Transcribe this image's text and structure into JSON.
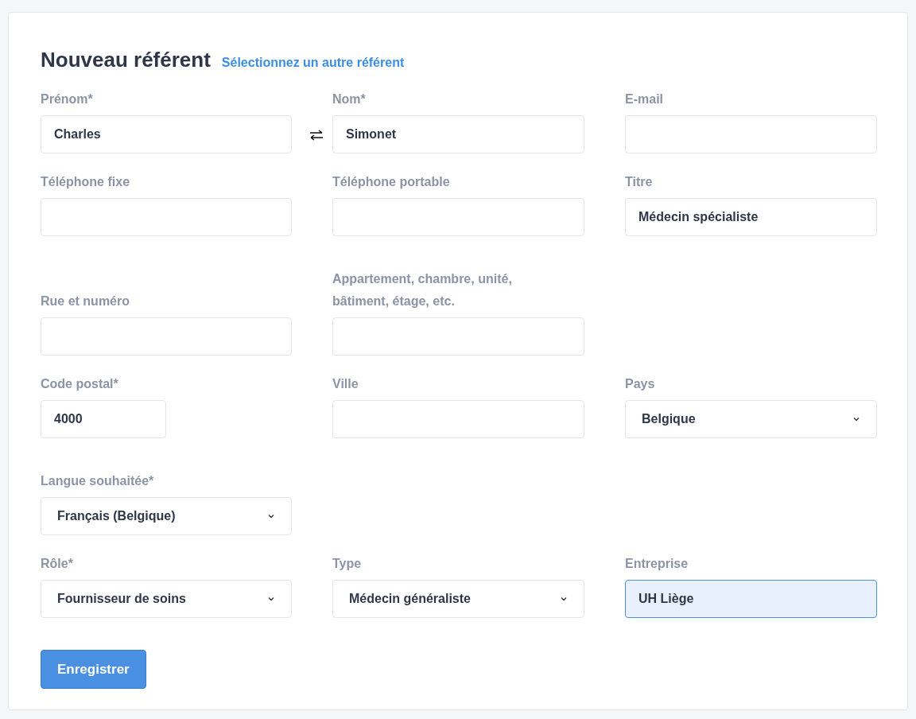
{
  "header": {
    "title": "Nouveau référent",
    "link": "Sélectionnez un autre référent"
  },
  "sections": [
    {
      "rows": [
        [
          {
            "kind": "text",
            "label": "Prénom*",
            "value": "Charles",
            "swap_button": true
          },
          {
            "kind": "text",
            "label": "Nom*",
            "value": "Simonet"
          },
          {
            "kind": "text",
            "label": "E-mail"
          }
        ],
        [
          {
            "kind": "text",
            "label": "Téléphone fixe"
          },
          {
            "kind": "text",
            "label": "Téléphone portable"
          },
          {
            "kind": "text",
            "label": "Titre",
            "value": "Médecin spécialiste"
          }
        ]
      ]
    },
    {
      "rows": [
        [
          {
            "kind": "text",
            "label": "Rue et numéro"
          },
          {
            "kind": "text",
            "label": "Appartement, chambre, unité, bâtiment, étage, etc."
          },
          {
            "kind": "empty"
          }
        ],
        [
          {
            "kind": "text",
            "label": "Code postal*",
            "value": "4000",
            "short": true
          },
          {
            "kind": "text",
            "label": "Ville"
          },
          {
            "kind": "select",
            "label": "Pays",
            "value": "Belgique"
          }
        ]
      ]
    },
    {
      "rows": [
        [
          {
            "kind": "select",
            "label": "Langue souhaitée*",
            "value": "Français (Belgique)"
          },
          {
            "kind": "empty"
          },
          {
            "kind": "empty"
          }
        ],
        [
          {
            "kind": "select",
            "label": "Rôle*",
            "value": "Fournisseur de soins"
          },
          {
            "kind": "select",
            "label": "Type",
            "value": "Médecin généraliste"
          },
          {
            "kind": "text",
            "label": "Entreprise",
            "value": "UH Liège",
            "focused": true
          }
        ]
      ]
    }
  ],
  "save_button": "Enregistrer"
}
